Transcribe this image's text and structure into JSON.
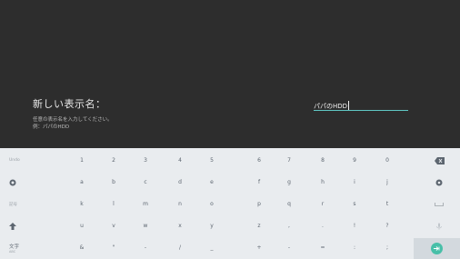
{
  "dialog": {
    "title": "新しい表示名：",
    "help_line1": "任意の表示名を入力してください。",
    "help_line2": "例：パパのHDD",
    "input_value": "パパのHDD"
  },
  "keyboard": {
    "row1": [
      "1",
      "2",
      "3",
      "4",
      "5",
      "6",
      "7",
      "8",
      "9",
      "0"
    ],
    "row2": [
      "a",
      "b",
      "c",
      "d",
      "e",
      "f",
      "g",
      "h",
      "i",
      "j"
    ],
    "row3": [
      "k",
      "l",
      "m",
      "n",
      "o",
      "p",
      "q",
      "r",
      "s",
      "t"
    ],
    "row4": [
      "u",
      "v",
      "w",
      "x",
      "y",
      "z",
      ",",
      ".",
      "!",
      "?"
    ],
    "row5": [
      "&",
      "\"",
      "-",
      "/",
      "_",
      "+",
      "-",
      "=",
      ":",
      ";"
    ],
    "left_labels": [
      "Undo",
      "",
      "記号",
      "",
      "文字"
    ],
    "left_labels_sub": [
      "",
      "",
      "",
      "",
      "ABC"
    ],
    "colors": {
      "accent": "#5fc7c4",
      "enter": "#48bfa8",
      "keyboard_bg": "#e9ecef",
      "dialog_bg": "#2d2d2d"
    },
    "icons": {
      "row1_right": "backspace-icon",
      "row2_left": "globe-icon",
      "row2_right": "microphone-icon",
      "row3_right": "space-icon",
      "row4_left": "shift-icon",
      "row4_right": "mic-alt-icon",
      "row5_right": "enter-icon"
    }
  }
}
